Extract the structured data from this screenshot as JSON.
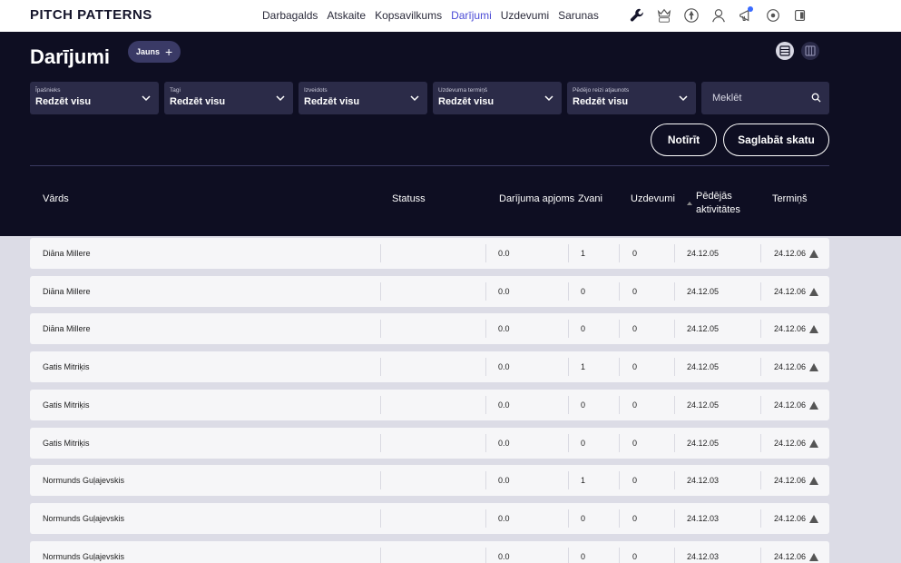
{
  "brand": "PITCH PATTERNS",
  "nav": [
    "Darbagalds",
    "Atskaite",
    "Kopsavilkums",
    "Darījumi",
    "Uzdevumi",
    "Sarunas"
  ],
  "nav_active": "Darījumi",
  "nav_icons": [
    "wrench-icon",
    "live-crown-icon",
    "rocket-icon",
    "coach-icon",
    "announce-icon",
    "settings-icon",
    "exit-icon"
  ],
  "page": {
    "title": "Darījumi",
    "new_label": "Jauns"
  },
  "filters": [
    {
      "label": "Īpašnieks",
      "value": "Redzēt visu"
    },
    {
      "label": "Tagi",
      "value": "Redzēt visu"
    },
    {
      "label": "Izveidots",
      "value": "Redzēt visu"
    },
    {
      "label": "Uzdevuma termiņš",
      "value": "Redzēt visu"
    },
    {
      "label": "Pēdējo reizi atjaunots",
      "value": "Redzēt visu"
    }
  ],
  "search": {
    "placeholder": "Meklēt"
  },
  "actions": {
    "clear": "Notīrīt",
    "save": "Saglabāt skatu"
  },
  "columns": {
    "name": "Vārds",
    "status": "Statuss",
    "amount": "Darījuma apjoms",
    "calls": "Zvani",
    "tasks": "Uzdevumi",
    "last_activity_1": "Pēdējās",
    "last_activity_2": "aktivitātes",
    "deadline": "Termiņš"
  },
  "rows": [
    {
      "name": "Diāna Millere",
      "status": "",
      "amount": "0.0",
      "calls": "1",
      "tasks": "0",
      "last": "24.12.05",
      "deadline": "24.12.06"
    },
    {
      "name": "Diāna Millere",
      "status": "",
      "amount": "0.0",
      "calls": "0",
      "tasks": "0",
      "last": "24.12.05",
      "deadline": "24.12.06"
    },
    {
      "name": "Diāna Millere",
      "status": "",
      "amount": "0.0",
      "calls": "0",
      "tasks": "0",
      "last": "24.12.05",
      "deadline": "24.12.06"
    },
    {
      "name": "Gatis Mitriķis",
      "status": "",
      "amount": "0.0",
      "calls": "1",
      "tasks": "0",
      "last": "24.12.05",
      "deadline": "24.12.06"
    },
    {
      "name": "Gatis Mitriķis",
      "status": "",
      "amount": "0.0",
      "calls": "0",
      "tasks": "0",
      "last": "24.12.05",
      "deadline": "24.12.06"
    },
    {
      "name": "Gatis Mitriķis",
      "status": "",
      "amount": "0.0",
      "calls": "0",
      "tasks": "0",
      "last": "24.12.05",
      "deadline": "24.12.06"
    },
    {
      "name": "Normunds Guļajevskis",
      "status": "",
      "amount": "0.0",
      "calls": "1",
      "tasks": "0",
      "last": "24.12.03",
      "deadline": "24.12.06"
    },
    {
      "name": "Normunds Guļajevskis",
      "status": "",
      "amount": "0.0",
      "calls": "0",
      "tasks": "0",
      "last": "24.12.03",
      "deadline": "24.12.06"
    },
    {
      "name": "Normunds Guļajevskis",
      "status": "",
      "amount": "0.0",
      "calls": "0",
      "tasks": "0",
      "last": "24.12.03",
      "deadline": "24.12.06"
    }
  ]
}
